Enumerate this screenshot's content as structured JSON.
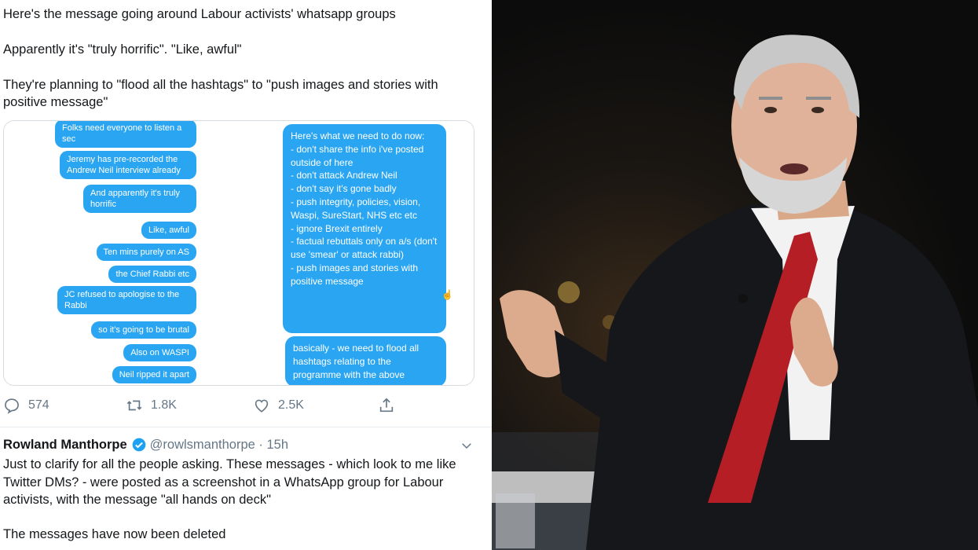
{
  "tweet": {
    "line1": "Here's the message going around Labour activists' whatsapp groups",
    "line2": "Apparently it's \"truly horrific\". \"Like, awful\"",
    "line3": "They're planning to \"flood all the hashtags\" to \"push images and stories with positive message\""
  },
  "chat": {
    "left_messages": [
      "Folks need everyone to listen a sec",
      "Jeremy has pre-recorded the Andrew Neil interview already",
      "And apparently it's truly horrific",
      "Like, awful",
      "Ten mins purely on AS",
      "the Chief Rabbi etc",
      "JC refused to apologise to the Rabbi",
      "so it's going to be brutal",
      "Also on WASPI",
      "Neil ripped it apart"
    ],
    "right_messages": [
      "Here's what we need to do now:\n- don't share the info i've posted outside of here\n- don't attack Andrew Neil\n- don't say it's gone badly\n- push integrity, policies, vision, Waspi, SureStart, NHS etc etc\n- ignore Brexit entirely\n- factual rebuttals only on a/s (don't use 'smear' or attack rabbi)\n- push images and stories with positive message",
      "basically - we need to flood all hashtags relating to the programme with the above"
    ]
  },
  "actions": {
    "replies": "574",
    "retweets": "1.8K",
    "likes": "2.5K"
  },
  "reply": {
    "name": "Rowland Manthorpe",
    "handle": "@rowlsmanthorpe · 15h",
    "body": "Just to clarify for all the people asking. These messages - which look to me like Twitter DMs? - were posted as a screenshot in a WhatsApp group for Labour activists, with the message \"all hands on deck\"",
    "body2": "The messages have now been deleted"
  },
  "colors": {
    "bubble": "#2aa5f2",
    "text": "#14171a",
    "muted": "#657786",
    "verified": "#1da1f2",
    "tie": "#b51e24"
  },
  "icons": [
    "reply-icon",
    "retweet-icon",
    "like-icon",
    "share-icon",
    "verified-icon",
    "chevron-down-icon"
  ]
}
